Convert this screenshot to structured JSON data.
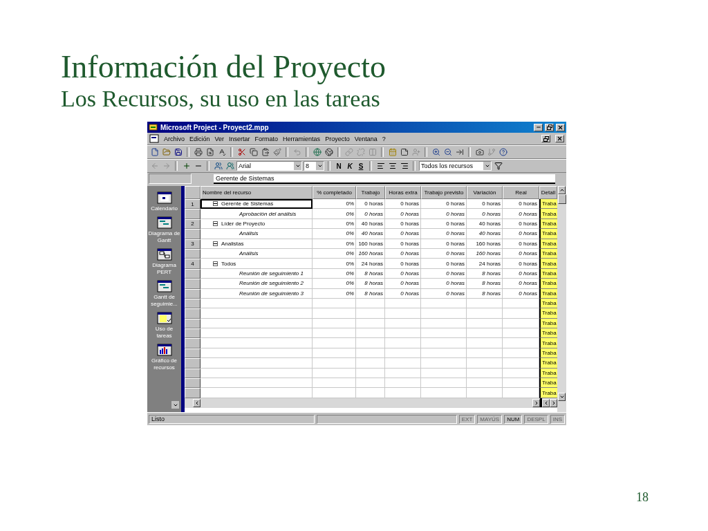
{
  "slide": {
    "title": "Información del Proyecto",
    "subtitle": "Los Recursos, su uso en las tareas",
    "page_number": "18"
  },
  "window": {
    "title": "Microsoft Project - Proyect2.mpp"
  },
  "menu": [
    "Archivo",
    "Edición",
    "Ver",
    "Insertar",
    "Formato",
    "Herramientas",
    "Proyecto",
    "Ventana",
    "?"
  ],
  "standard_toolbar": [
    [
      {
        "disabled": false
      },
      {
        "disabled": false
      },
      {
        "disabled": false
      }
    ],
    [
      {
        "disabled": false
      },
      {
        "disabled": false
      },
      {
        "disabled": false
      }
    ],
    [
      {
        "disabled": false
      },
      {
        "disabled": false
      },
      {
        "disabled": false
      },
      {
        "disabled": false
      }
    ],
    [
      {
        "disabled": true
      }
    ],
    [
      {
        "disabled": false
      },
      {
        "disabled": false
      }
    ],
    [
      {
        "disabled": true
      },
      {
        "disabled": true
      },
      {
        "disabled": true
      }
    ],
    [
      {
        "disabled": false
      },
      {
        "disabled": false
      },
      {
        "disabled": true
      }
    ],
    [
      {
        "disabled": false
      },
      {
        "disabled": false
      },
      {
        "disabled": false
      }
    ],
    [
      {
        "disabled": false
      },
      {
        "disabled": true
      },
      {
        "disabled": false
      }
    ]
  ],
  "formatting_toolbar": {
    "nav": [
      {
        "disabled": true
      },
      {
        "disabled": true
      }
    ],
    "font": "Arial",
    "size": "8",
    "styles": [
      "N",
      "K",
      "S"
    ],
    "filter": "Todos los recursos"
  },
  "entry_bar": {
    "value": "Gerente de Sistemas"
  },
  "view_bar": [
    "Calendario",
    "Diagrama de Gantt",
    "Diagrama PERT",
    "Gantt de seguimie...",
    "Uso de tareas",
    "Gráfico de recursos"
  ],
  "table": {
    "columns": [
      "Nombre del recurso",
      "% completado",
      "Trabajo",
      "Horas extra",
      "Trabajo previsto",
      "Variación",
      "Real",
      "Detall"
    ],
    "rows": [
      {
        "kind": "resource",
        "id": "1",
        "expanded": true,
        "selected": true,
        "name": "Gerente de Sistemas",
        "values": [
          "0%",
          "0 horas",
          "0 horas",
          "0 horas",
          "0 horas",
          "0 horas"
        ]
      },
      {
        "kind": "assignment",
        "selected": false,
        "name": "Aprobación del análisis",
        "values": [
          "0%",
          "0 horas",
          "0 horas",
          "0 horas",
          "0 horas",
          "0 horas"
        ]
      },
      {
        "kind": "resource",
        "id": "2",
        "expanded": true,
        "selected": false,
        "name": "Líder de Proyecto",
        "values": [
          "0%",
          "40 horas",
          "0 horas",
          "0 horas",
          "40 horas",
          "0 horas"
        ]
      },
      {
        "kind": "assignment",
        "selected": false,
        "name": "Análisis",
        "values": [
          "0%",
          "40 horas",
          "0 horas",
          "0 horas",
          "40 horas",
          "0 horas"
        ]
      },
      {
        "kind": "resource",
        "id": "3",
        "expanded": true,
        "selected": false,
        "name": "Analistas",
        "values": [
          "0%",
          "160 horas",
          "0 horas",
          "0 horas",
          "160 horas",
          "0 horas"
        ]
      },
      {
        "kind": "assignment",
        "selected": false,
        "name": "Análisis",
        "values": [
          "0%",
          "160 horas",
          "0 horas",
          "0 horas",
          "160 horas",
          "0 horas"
        ]
      },
      {
        "kind": "resource",
        "id": "4",
        "expanded": true,
        "selected": false,
        "name": "Todos",
        "values": [
          "0%",
          "24 horas",
          "0 horas",
          "0 horas",
          "24 horas",
          "0 horas"
        ]
      },
      {
        "kind": "assignment",
        "selected": false,
        "name": "Reunión de seguimiento 1",
        "values": [
          "0%",
          "8 horas",
          "0 horas",
          "0 horas",
          "8 horas",
          "0 horas"
        ]
      },
      {
        "kind": "assignment",
        "selected": false,
        "name": "Reunión de seguimiento 2",
        "values": [
          "0%",
          "8 horas",
          "0 horas",
          "0 horas",
          "8 horas",
          "0 horas"
        ]
      },
      {
        "kind": "assignment",
        "selected": false,
        "name": "Reunión de seguimiento 3",
        "values": [
          "0%",
          "8 horas",
          "0 horas",
          "0 horas",
          "8 horas",
          "0 horas"
        ]
      }
    ],
    "detail_cells": [
      "Traba",
      "Traba",
      "Traba",
      "Traba",
      "Traba",
      "Traba",
      "Traba",
      "Traba",
      "Traba",
      "Traba",
      "Traba",
      "Traba",
      "Traba",
      "Traba",
      "Traba",
      "Traba",
      "Traba",
      "Traba",
      "Traba",
      "Traba"
    ]
  },
  "status_bar": {
    "text": "Listo",
    "indicators": [
      {
        "label": "EXT",
        "on": false
      },
      {
        "label": "MAYÚS",
        "on": false
      },
      {
        "label": "NUM",
        "on": true
      },
      {
        "label": "DESPL",
        "on": false
      },
      {
        "label": "INS",
        "on": false
      }
    ]
  }
}
